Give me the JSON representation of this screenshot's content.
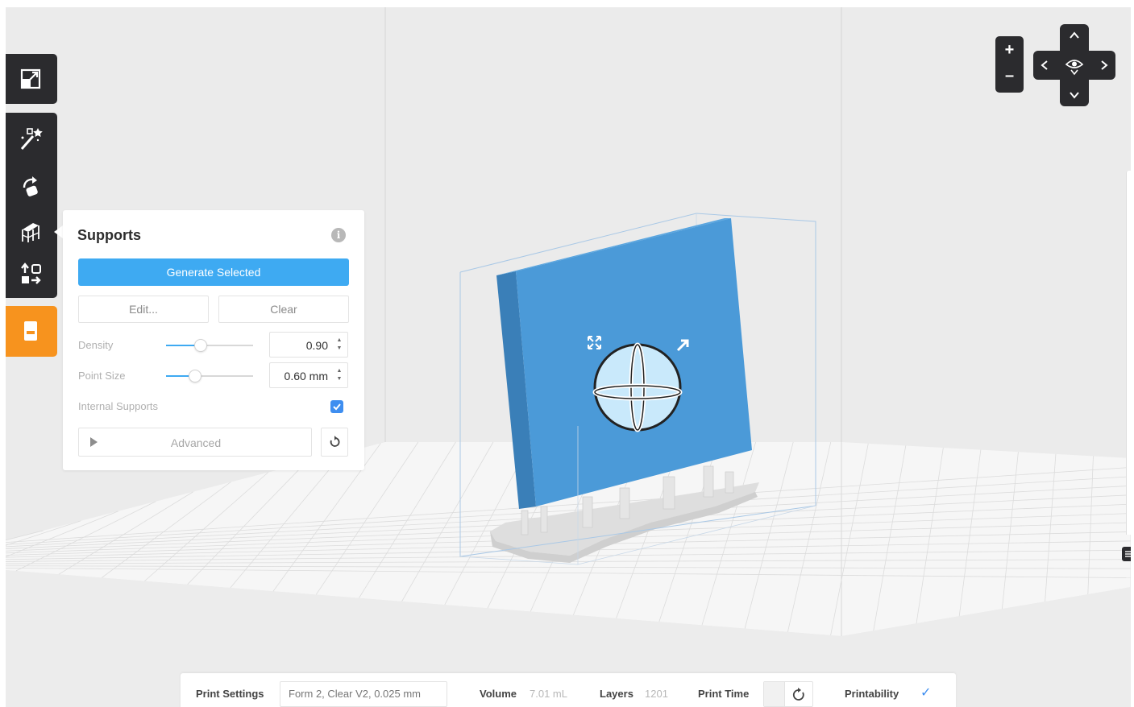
{
  "supports_panel": {
    "title": "Supports",
    "info_icon": "i",
    "generate_label": "Generate Selected",
    "edit_label": "Edit...",
    "clear_label": "Clear",
    "density": {
      "label": "Density",
      "value": "0.90",
      "slider_fraction": 0.4
    },
    "point_size": {
      "label": "Point Size",
      "value": "0.60 mm",
      "slider_fraction": 0.33
    },
    "internal_supports": {
      "label": "Internal Supports",
      "checked": true
    },
    "advanced_label": "Advanced"
  },
  "toolbar": {
    "icons": [
      "scale-icon",
      "magic-wand-icon",
      "rotate-icon",
      "supports-icon",
      "layout-icon",
      "print-job-icon"
    ],
    "active_color": "#f7931e"
  },
  "nav": {
    "zoom_in": "+",
    "zoom_out": "–"
  },
  "status_bar": {
    "print_settings_label": "Print Settings",
    "print_settings_value": "Form 2, Clear V2, 0.025 mm",
    "volume_label": "Volume",
    "volume_value": "7.01 mL",
    "layers_label": "Layers",
    "layers_value": "1201",
    "print_time_label": "Print Time",
    "printability_label": "Printability",
    "printability_status": "✓"
  },
  "colors": {
    "accent": "#3eaaf2",
    "model": "#4a98d6",
    "toolbar": "#2b2b2e",
    "checkbox": "#3e8ef0"
  }
}
